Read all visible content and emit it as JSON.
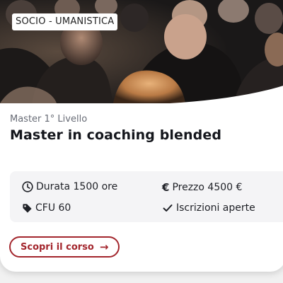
{
  "category_tag": "SOCIO - UMANISTICA",
  "course": {
    "level": "Master 1° Livello",
    "title": "Master in coaching blended"
  },
  "details": {
    "duration": "Durata 1500 ore",
    "price": "Prezzo 4500 €",
    "cfu": "CFU 60",
    "enrollment": "Iscrizioni aperte"
  },
  "cta_label": "Scopri il corso",
  "cta_arrow": "→",
  "icons": {
    "duration": "clock-icon",
    "price": "euro-icon",
    "cfu": "tag-icon",
    "enrollment": "check-icon",
    "cta": "arrow-right-icon"
  },
  "colors": {
    "accent": "#a3262d",
    "text_dark": "#14161c",
    "text_muted": "#676b75",
    "info_bg": "#f4f4f6"
  }
}
